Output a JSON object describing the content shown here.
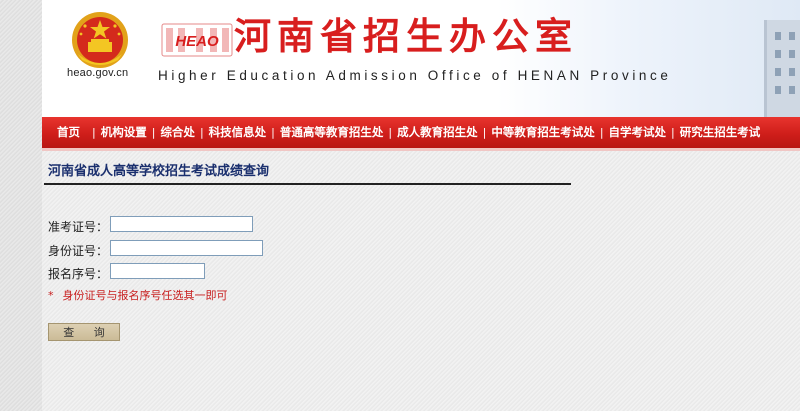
{
  "header": {
    "site_domain": "heao.gov.cn",
    "logo_text": "HEAO",
    "title_cn": "河南省招生办公室",
    "title_en": "Higher Education Admission Office of HENAN Province"
  },
  "nav": {
    "items": [
      {
        "label": "首页"
      },
      {
        "label": "机构设置"
      },
      {
        "label": "综合处"
      },
      {
        "label": "科技信息处"
      },
      {
        "label": "普通高等教育招生处"
      },
      {
        "label": "成人教育招生处"
      },
      {
        "label": "中等教育招生考试处"
      },
      {
        "label": "自学考试处"
      },
      {
        "label": "研究生招生考试"
      }
    ]
  },
  "query": {
    "title": "河南省成人高等学校招生考试成绩查询",
    "fields": {
      "exam_number": {
        "label": "准考证号：",
        "value": ""
      },
      "id_number": {
        "label": "身份证号：",
        "value": ""
      },
      "registration_number": {
        "label": "报名序号：",
        "value": ""
      }
    },
    "note_star": "*",
    "note_text": "身份证号与报名序号任选其一即可",
    "button_label": "查 询"
  },
  "colors": {
    "nav_red": "#cf1e1a",
    "title_red": "#d81e1e",
    "heading_blue": "#1a2f6e",
    "note_red": "#c81e1e"
  }
}
